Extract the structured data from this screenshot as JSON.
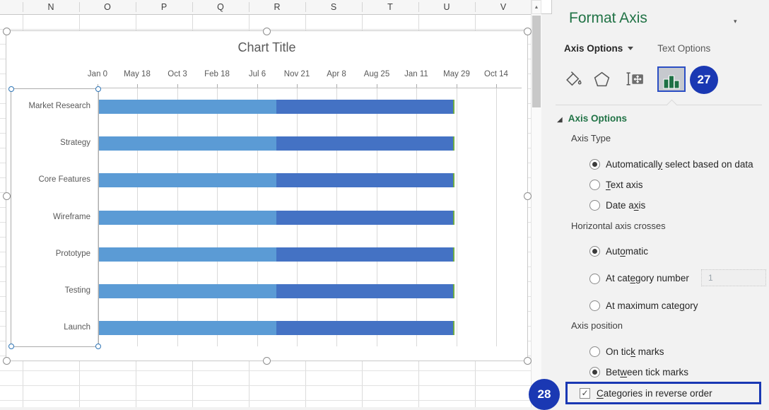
{
  "sheet": {
    "columns": [
      "N",
      "O",
      "P",
      "Q",
      "R",
      "S",
      "T",
      "U",
      "V"
    ]
  },
  "icons": {
    "scroll_up": "▲",
    "pane_collapse": "▾",
    "section_expanded": "◢",
    "check": "✓"
  },
  "chart_data": {
    "type": "bar",
    "orientation": "horizontal-stacked",
    "title": "Chart Title",
    "categories": [
      "Market Research",
      "Strategy",
      "Core Features",
      "Wireframe",
      "Prototype",
      "Testing",
      "Launch"
    ],
    "categories_in_reverse_order": true,
    "x_tick_labels": [
      "Jan 0",
      "May 18",
      "Oct 3",
      "Feb 18",
      "Jul 6",
      "Nov 21",
      "Apr 8",
      "Aug 25",
      "Jan 11",
      "May 29",
      "Oct 14"
    ],
    "x_tick_values_days": [
      0,
      138,
      276,
      414,
      552,
      690,
      828,
      966,
      1104,
      1242,
      1380
    ],
    "x_axis_max_days": 1468,
    "grid": true,
    "legend": false,
    "series": [
      {
        "color": "#5B9BD5",
        "values": [
          617,
          617,
          617,
          617,
          617,
          617,
          617
        ]
      },
      {
        "color": "#4472C4",
        "values": [
          612,
          612,
          612,
          612,
          612,
          612,
          612
        ]
      },
      {
        "color": "#70AD47",
        "values": [
          5,
          5,
          5,
          5,
          5,
          5,
          5
        ]
      }
    ]
  },
  "panel": {
    "title": "Format Axis",
    "tabs": {
      "active": "Axis Options",
      "idle": "Text Options"
    },
    "toolbar_badge": "27",
    "checkbox_badge": "28",
    "section_header": "Axis Options",
    "axis_type": {
      "label": "Axis Type",
      "options": [
        {
          "label": "Automatically select based on data",
          "u": 12,
          "selected": true
        },
        {
          "label": "Text axis",
          "u": 0,
          "selected": false
        },
        {
          "label": "Date axis",
          "u": 6,
          "selected": false
        }
      ]
    },
    "axis_crosses": {
      "label": "Horizontal axis crosses",
      "options": [
        {
          "label": "Automatic",
          "u": 3,
          "selected": true
        },
        {
          "label": "At category number",
          "u": 6,
          "selected": false
        },
        {
          "label": "At maximum category",
          "u": 15,
          "selected": false
        }
      ],
      "category_number_value": "1"
    },
    "axis_position": {
      "label": "Axis position",
      "options": [
        {
          "label": "On tick marks",
          "u": 6,
          "selected": false
        },
        {
          "label": "Between tick marks",
          "u": 3,
          "selected": true
        }
      ]
    },
    "reverse_checkbox": {
      "label": "Categories in reverse order",
      "u": 0,
      "checked": true
    }
  },
  "colors": {
    "excel_green": "#217346",
    "bar_light_blue": "#5B9BD5",
    "bar_dark_blue": "#4472C4",
    "bar_green": "#70AD47",
    "annotation_blue": "#1A38B3",
    "selected_icon_border": "#2B4EC4"
  }
}
